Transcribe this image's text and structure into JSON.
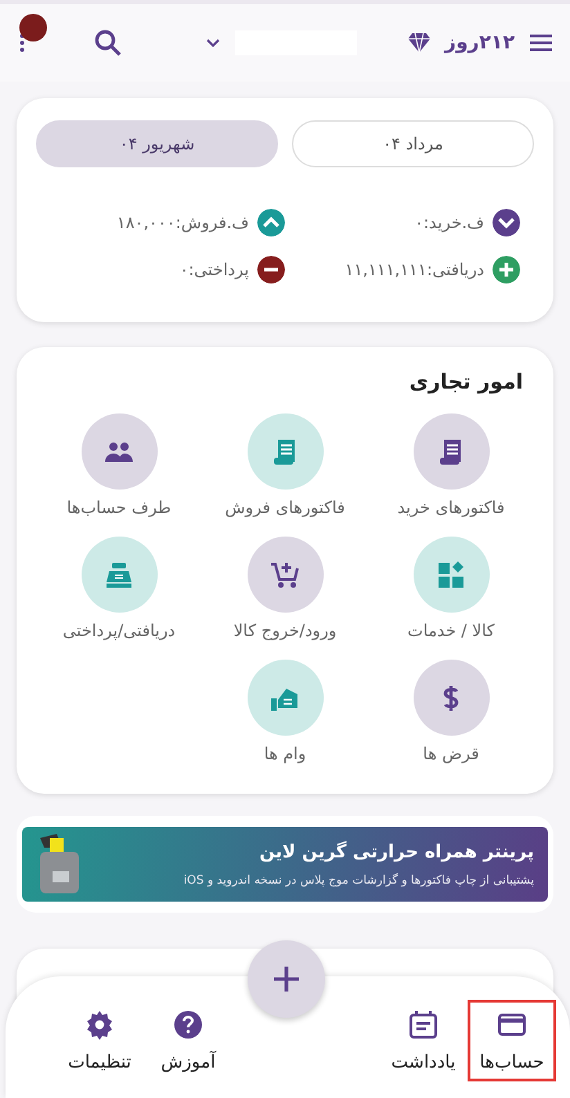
{
  "header": {
    "days": "۲۱۲روز"
  },
  "period_tabs": [
    {
      "label": "مرداد ۰۴",
      "selected": false
    },
    {
      "label": "شهریور ۰۴",
      "selected": true
    }
  ],
  "stats": [
    {
      "kind": "down",
      "label": "ف.خرید:۰",
      "color": "#5b3f8c"
    },
    {
      "kind": "up",
      "label": "ف.فروش:۱۸۰,۰۰۰",
      "color": "#1a9a98"
    },
    {
      "kind": "plus",
      "label": "دریافتی:۱۱,۱۱۱,۱۱۱",
      "color": "#2e9e62"
    },
    {
      "kind": "minus",
      "label": "پرداختی:۰",
      "color": "#861d1d"
    }
  ],
  "business": {
    "title": "امور تجاری",
    "items": [
      {
        "kind": "receipt",
        "label": "فاکتورهای خرید",
        "color": "#5b3f8c"
      },
      {
        "kind": "receipt",
        "label": "فاکتورهای فروش",
        "color": "#1a9a98"
      },
      {
        "kind": "people",
        "label": "طرف حساب‌ها",
        "color": "#5b3f8c"
      },
      {
        "kind": "shapes",
        "label": "کالا / خدمات",
        "color": "#1a9a98"
      },
      {
        "kind": "cart",
        "label": "ورود/خروج کالا",
        "color": "#5b3f8c"
      },
      {
        "kind": "register",
        "label": "دریافتی/پرداختی",
        "color": "#1a9a98"
      },
      {
        "kind": "dollar",
        "label": "قرض ها",
        "color": "#5b3f8c"
      },
      {
        "kind": "loan",
        "label": "وام ها",
        "color": "#1a9a98"
      }
    ]
  },
  "banner": {
    "title": "پرینتر همراه حرارتی گرین لاین",
    "subtitle": "پشتیبانی از چاپ فاکتورها و گزارشات موج پلاس در نسخه اندروید و iOS"
  },
  "bottom_nav": [
    {
      "kind": "card",
      "label": "حساب‌ها",
      "selected": true
    },
    {
      "kind": "note",
      "label": "یادداشت",
      "selected": false
    },
    {
      "kind": "fab"
    },
    {
      "kind": "help",
      "label": "آموزش",
      "selected": false
    },
    {
      "kind": "gear",
      "label": "تنظیمات",
      "selected": false
    }
  ]
}
